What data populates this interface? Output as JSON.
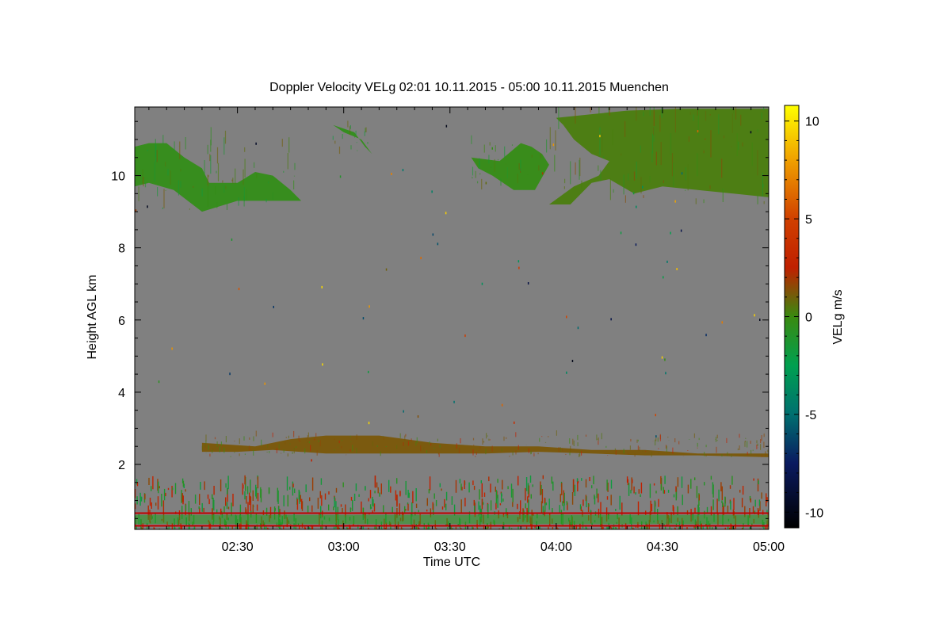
{
  "chart_data": {
    "type": "heatmap",
    "title": "Doppler Velocity VELg   02:01 10.11.2015 - 05:00 10.11.2015 Muenchen",
    "xlabel": "Time UTC",
    "ylabel": "Height AGL km",
    "colorbar_label": "VELg m/s",
    "x_ticks": [
      "02:30",
      "03:00",
      "03:30",
      "04:00",
      "04:30",
      "05:00"
    ],
    "x_tick_values_min": [
      150,
      180,
      210,
      240,
      270,
      300
    ],
    "xlim_min": [
      121,
      300
    ],
    "y_ticks": [
      2,
      4,
      6,
      8,
      10
    ],
    "ylim": [
      0.2,
      11.9
    ],
    "colorbar_ticks": [
      10,
      5,
      0,
      -5,
      -10
    ],
    "clim": [
      -10.8,
      10.8
    ],
    "background_color": "#808080",
    "colormap": [
      {
        "v": -10.8,
        "c": "#000000"
      },
      {
        "v": -7.5,
        "c": "#0a1a60"
      },
      {
        "v": -5.0,
        "c": "#007070"
      },
      {
        "v": -2.5,
        "c": "#00a050"
      },
      {
        "v": 0.0,
        "c": "#3a8a10"
      },
      {
        "v": 2.5,
        "c": "#c02000"
      },
      {
        "v": 5.0,
        "c": "#d04000"
      },
      {
        "v": 8.0,
        "c": "#f0a000"
      },
      {
        "v": 10.8,
        "c": "#ffff00"
      }
    ],
    "layers": [
      {
        "name": "cirrus-left",
        "v": -0.3,
        "top": [
          [
            121,
            10.8
          ],
          [
            125,
            10.9
          ],
          [
            130,
            10.9
          ],
          [
            135,
            10.5
          ],
          [
            140,
            10.2
          ],
          [
            142,
            9.8
          ],
          [
            150,
            9.8
          ],
          [
            155,
            10.1
          ],
          [
            160,
            10.0
          ],
          [
            165,
            9.6
          ],
          [
            168,
            9.3
          ],
          [
            150,
            9.3
          ],
          [
            140,
            9.0
          ],
          [
            132,
            9.6
          ],
          [
            125,
            9.8
          ],
          [
            121,
            9.7
          ]
        ]
      },
      {
        "name": "cirrus-mid",
        "v": -0.4,
        "top": [
          [
            177,
            11.4
          ],
          [
            183,
            11.2
          ],
          [
            186,
            10.8
          ],
          [
            188,
            10.6
          ],
          [
            185,
            11.0
          ],
          [
            180,
            11.2
          ]
        ]
      },
      {
        "name": "cirrus-right",
        "v": -0.2,
        "top": [
          [
            224,
            10.4
          ],
          [
            230,
            10.9
          ],
          [
            233,
            10.8
          ],
          [
            236,
            10.6
          ],
          [
            238,
            10.3
          ],
          [
            234,
            9.6
          ],
          [
            228,
            9.6
          ],
          [
            222,
            10.0
          ],
          [
            218,
            10.2
          ],
          [
            216,
            10.5
          ]
        ]
      },
      {
        "name": "cirrus-far-right",
        "v": 0.3,
        "top": [
          [
            240,
            11.6
          ],
          [
            250,
            11.7
          ],
          [
            260,
            11.8
          ],
          [
            275,
            11.85
          ],
          [
            300,
            11.85
          ],
          [
            300,
            9.4
          ],
          [
            290,
            9.5
          ],
          [
            280,
            9.6
          ],
          [
            270,
            9.7
          ],
          [
            262,
            9.5
          ],
          [
            255,
            9.9
          ],
          [
            250,
            9.8
          ],
          [
            244,
            9.2
          ],
          [
            238,
            9.2
          ],
          [
            245,
            9.7
          ],
          [
            252,
            10.0
          ],
          [
            255,
            10.4
          ],
          [
            250,
            10.6
          ],
          [
            245,
            11.0
          ],
          [
            242,
            11.4
          ]
        ]
      },
      {
        "name": "midlevel-layer",
        "v": 1.2,
        "top": [
          [
            140,
            2.6
          ],
          [
            155,
            2.5
          ],
          [
            165,
            2.7
          ],
          [
            175,
            2.8
          ],
          [
            190,
            2.8
          ],
          [
            205,
            2.6
          ],
          [
            220,
            2.5
          ],
          [
            235,
            2.5
          ],
          [
            250,
            2.4
          ],
          [
            265,
            2.4
          ],
          [
            280,
            2.3
          ],
          [
            300,
            2.3
          ],
          [
            300,
            2.2
          ],
          [
            280,
            2.25
          ],
          [
            265,
            2.25
          ],
          [
            250,
            2.3
          ],
          [
            235,
            2.35
          ],
          [
            220,
            2.3
          ],
          [
            200,
            2.3
          ],
          [
            175,
            2.3
          ],
          [
            160,
            2.4
          ],
          [
            150,
            2.35
          ],
          [
            140,
            2.35
          ]
        ]
      }
    ],
    "boundary_layer": {
      "top_km": 1.7,
      "v_mix": [
        -2.0,
        3.0
      ]
    },
    "red_lines_km": [
      0.65,
      0.3
    ]
  }
}
